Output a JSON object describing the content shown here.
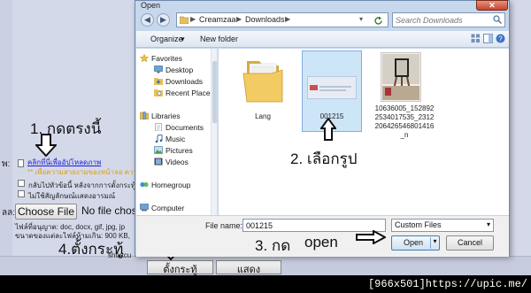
{
  "background_page": {
    "field_labels": {
      "attach": "พ:",
      "file": "ลล:"
    },
    "attach_link": "คลิกที่นี่เพื่ออัปโหลดภาพ",
    "attach_note": "** เพื่อความสวยงามของหน้าจอ ความกว้างไม่ควรเกิน",
    "options": [
      "กลับไปหัวข้อนี้ หลังจากการตั้งกระทู้",
      "ไม่ใช้สัญลักษณ์แสดงอารมณ์"
    ],
    "choose_file_label": "Choose File",
    "no_file_text": "No file chose",
    "allowed_types": "ไฟล์ที่อนุญาต: doc, docx, gif, jpg, jp",
    "size_limit": "ขนาดของแต่ละไฟล์ห้ามเกิน: 900 KB,",
    "shortcut_text": "shortcu",
    "post_button": "ตั้งกระทู้",
    "preview_button": "แสดงตัวอย่าง"
  },
  "annotations": {
    "step1": "1. กดตรงนี้",
    "step2": "2. เลือกรูป",
    "step3_a": "3. กด",
    "step3_b": "open",
    "step4": "4.ตั้งกระทู้"
  },
  "dialog": {
    "title": "Open",
    "close_glyph": "✕",
    "nav_back": "◀",
    "nav_forward": "▶",
    "breadcrumb": [
      "Creamzaa",
      "Downloads"
    ],
    "breadcrumb_sep": "▶",
    "search_placeholder": "Search Downloads",
    "toolbar": {
      "organize": "Organize",
      "organize_caret": "▾",
      "new_folder": "New folder"
    },
    "nav_groups": [
      {
        "label": "Favorites",
        "items": [
          "Desktop",
          "Downloads",
          "Recent Places"
        ]
      },
      {
        "label": "Libraries",
        "items": [
          "Documents",
          "Music",
          "Pictures",
          "Videos"
        ]
      },
      {
        "label": "Homegroup",
        "items": []
      },
      {
        "label": "Computer",
        "items": []
      }
    ],
    "files": [
      {
        "name": "Lang",
        "kind": "folder"
      },
      {
        "name": "001215",
        "kind": "image",
        "selected": true
      },
      {
        "name": "10636005_152892\n2534017535_2312\n206426546801416\n_n",
        "kind": "image"
      }
    ],
    "filename_label": "File name:",
    "filename_value": "001215",
    "filetype_value": "Custom Files",
    "dropdown_caret": "▾",
    "open_label": "Open",
    "cancel_label": "Cancel"
  },
  "watermark": "[966x501]https://upic.me/",
  "colors": {
    "annotation_text": "#111111",
    "link": "#1b1bd6",
    "note": "#e0a000"
  }
}
